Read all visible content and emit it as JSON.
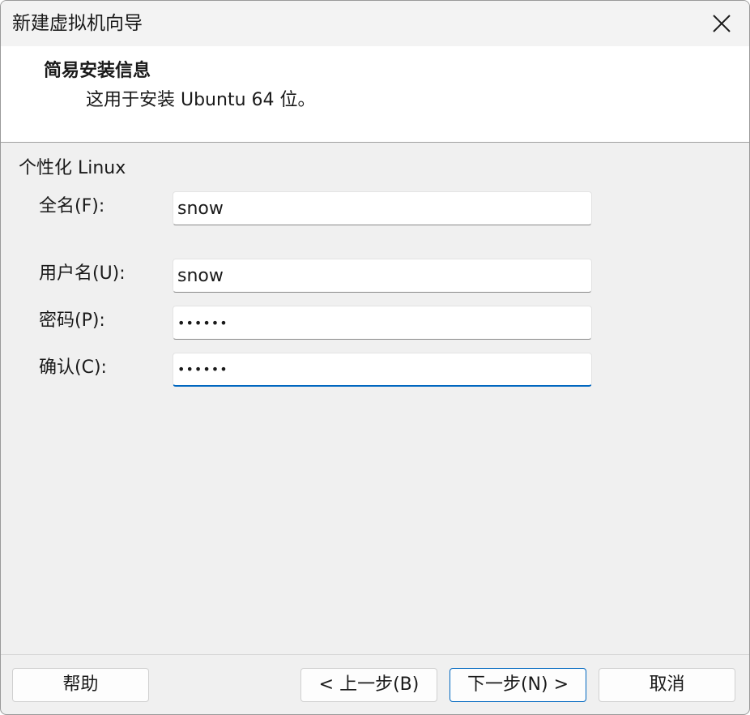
{
  "window": {
    "title": "新建虚拟机向导"
  },
  "header": {
    "title": "简易安装信息",
    "subtitle": "这用于安装 Ubuntu 64 位。"
  },
  "group": {
    "label": "个性化 Linux"
  },
  "fields": {
    "fullname": {
      "label": "全名(F):",
      "value": "snow"
    },
    "username": {
      "label": "用户名(U):",
      "value": "snow"
    },
    "password": {
      "label": "密码(P):",
      "value": "••••••"
    },
    "confirm": {
      "label": "确认(C):",
      "value": "••••••"
    }
  },
  "buttons": {
    "help": "帮助",
    "back": "< 上一步(B)",
    "next": "下一步(N) >",
    "cancel": "取消"
  },
  "colors": {
    "accent": "#0067c0",
    "window_bg": "#f0f0f0",
    "header_bg": "#ffffff"
  },
  "icons": {
    "close": "close-icon"
  }
}
